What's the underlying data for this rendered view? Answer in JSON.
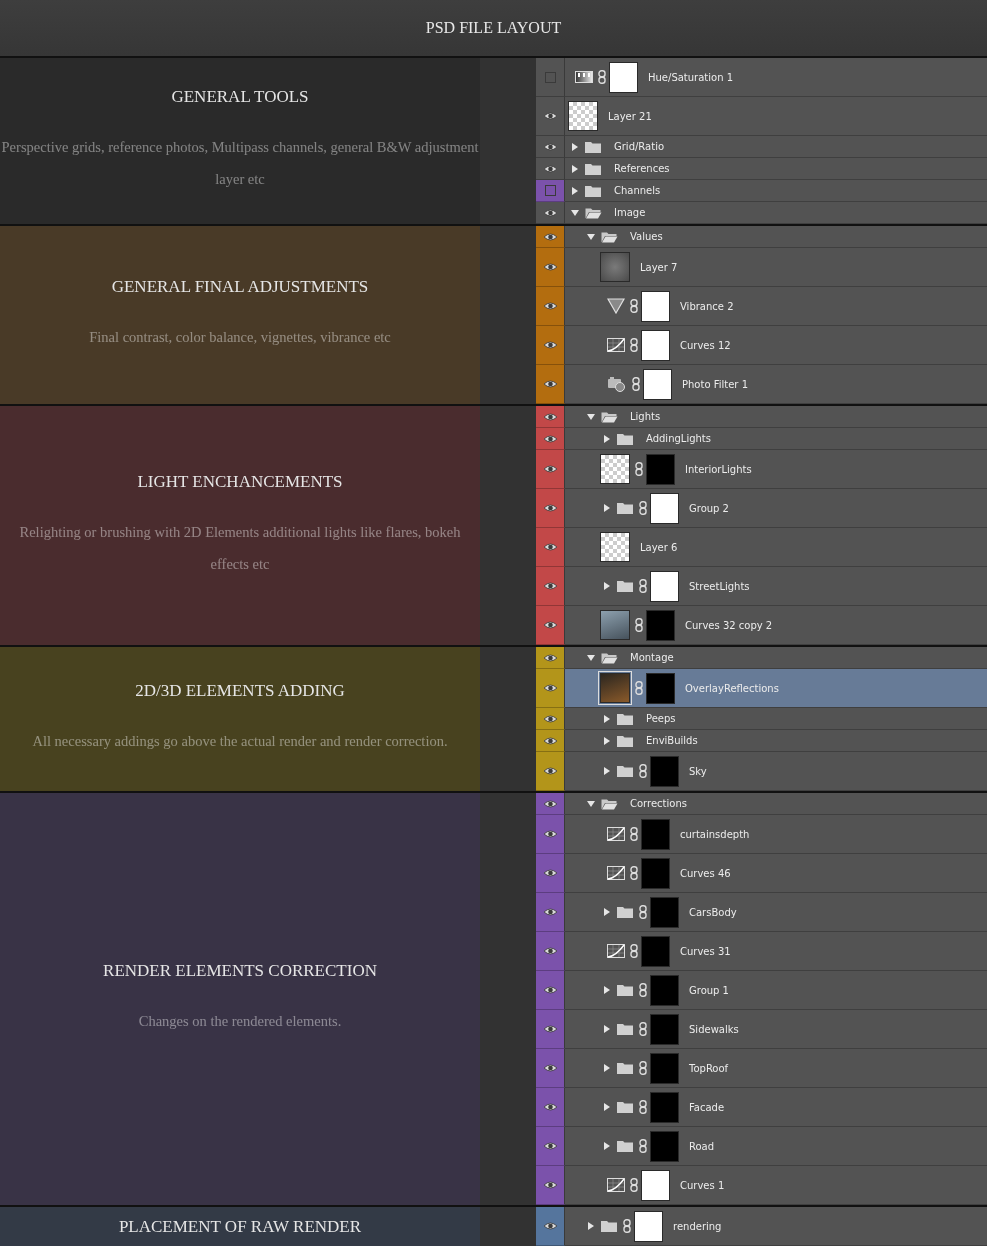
{
  "header": {
    "title": "PSD FILE LAYOUT"
  },
  "sections": [
    {
      "title": "GENERAL TOOLS",
      "description": "Perspective grids, reference photos, Multipass channels, general B&W adjustment layer etc",
      "color": "#2a2a2a",
      "layers": [
        {
          "name": "Hue/Saturation 1",
          "kind": "huesat",
          "visible": false,
          "color": "#535353",
          "selected": false,
          "mask": true,
          "mask_dark": false
        },
        {
          "name": "Layer 21",
          "kind": "transparent",
          "visible": true,
          "color": "#535353",
          "selected": false
        },
        {
          "name": "Grid/Ratio",
          "kind": "group",
          "visible": true,
          "color": "#535353",
          "selected": false,
          "expanded": false
        },
        {
          "name": "References",
          "kind": "group",
          "visible": true,
          "color": "#535353",
          "selected": false,
          "expanded": false
        },
        {
          "name": "Channels",
          "kind": "group",
          "visible": false,
          "color": "#7b52ab",
          "selected": false,
          "expanded": false
        },
        {
          "name": "Image",
          "kind": "group",
          "visible": true,
          "color": "#535353",
          "selected": false,
          "expanded": true
        }
      ]
    },
    {
      "title": "GENERAL FINAL ADJUSTMENTS",
      "description": "Final contrast, color balance, vignettes, vibrance etc",
      "color": "#493a27",
      "layers": [
        {
          "name": "Values",
          "kind": "group",
          "visible": true,
          "color": "#b36d0f",
          "selected": false,
          "expanded": true,
          "children": [
            {
              "name": "Layer 7",
              "kind": "shade",
              "visible": true,
              "color": "#b36d0f",
              "selected": false
            },
            {
              "name": "Vibrance 2",
              "kind": "vibrance",
              "visible": true,
              "color": "#b36d0f",
              "selected": false,
              "mask": true,
              "mask_dark": false
            },
            {
              "name": "Curves 12",
              "kind": "curves",
              "visible": true,
              "color": "#b36d0f",
              "selected": false,
              "mask": true,
              "mask_dark": false
            },
            {
              "name": "Photo Filter 1",
              "kind": "photofilter",
              "visible": true,
              "color": "#b36d0f",
              "selected": false,
              "mask": true,
              "mask_dark": false
            }
          ]
        }
      ]
    },
    {
      "title": "LIGHT ENCHANCEMENTS",
      "description": "Relighting or brushing with 2D Elements additional lights like flares, bokeh effects etc",
      "color": "#4a2c2e",
      "layers": [
        {
          "name": "Lights",
          "kind": "group",
          "visible": true,
          "color": "#c24848",
          "selected": false,
          "expanded": true,
          "children": [
            {
              "name": "AddingLights",
              "kind": "group",
              "visible": true,
              "color": "#c24848",
              "selected": false,
              "expanded": false
            },
            {
              "name": "InteriorLights",
              "kind": "transparent",
              "visible": true,
              "color": "#c24848",
              "selected": false,
              "mask": true,
              "mask_dark": true
            },
            {
              "name": "Group 2",
              "kind": "group",
              "visible": true,
              "color": "#c24848",
              "selected": false,
              "expanded": false,
              "mask": true,
              "mask_dark": false
            },
            {
              "name": "Layer 6",
              "kind": "transparent",
              "visible": true,
              "color": "#c24848",
              "selected": false
            },
            {
              "name": "StreetLights",
              "kind": "group",
              "visible": true,
              "color": "#c24848",
              "selected": false,
              "expanded": false,
              "mask": true,
              "mask_dark": false
            },
            {
              "name": "Curves 32 copy 2",
              "kind": "photo",
              "visible": true,
              "color": "#c24848",
              "selected": false,
              "mask": true,
              "mask_dark": true
            }
          ]
        }
      ]
    },
    {
      "title": "2D/3D ELEMENTS ADDING",
      "description": "All necessary addings go above the actual render and render correction.",
      "color": "#48421f",
      "layers": [
        {
          "name": "Montage",
          "kind": "group",
          "visible": true,
          "color": "#b3951a",
          "selected": false,
          "expanded": true,
          "children": [
            {
              "name": "OverlayReflections",
              "kind": "photo",
              "visible": true,
              "color": "#b3951a",
              "selected": true,
              "mask": true,
              "mask_dark": true
            },
            {
              "name": "Peeps",
              "kind": "group",
              "visible": true,
              "color": "#b3951a",
              "selected": false,
              "expanded": false
            },
            {
              "name": "EnviBuilds",
              "kind": "group",
              "visible": true,
              "color": "#b3951a",
              "selected": false,
              "expanded": false
            },
            {
              "name": "Sky",
              "kind": "group",
              "visible": true,
              "color": "#b3951a",
              "selected": false,
              "expanded": false,
              "mask": true,
              "mask_dark": true
            }
          ]
        }
      ]
    },
    {
      "title": "RENDER ELEMENTS CORRECTION",
      "description": "Changes on the rendered elements.",
      "color": "#393346",
      "layers": [
        {
          "name": "Corrections",
          "kind": "group",
          "visible": true,
          "color": "#7b52ab",
          "selected": false,
          "expanded": true,
          "children": [
            {
              "name": "curtainsdepth",
              "kind": "curves",
              "visible": true,
              "color": "#7b52ab",
              "selected": false,
              "mask": true,
              "mask_dark": true
            },
            {
              "name": "Curves 46",
              "kind": "curves",
              "visible": true,
              "color": "#7b52ab",
              "selected": false,
              "mask": true,
              "mask_dark": true
            },
            {
              "name": "CarsBody",
              "kind": "group",
              "visible": true,
              "color": "#7b52ab",
              "selected": false,
              "expanded": false,
              "mask": true,
              "mask_dark": true
            },
            {
              "name": "Curves 31",
              "kind": "curves",
              "visible": true,
              "color": "#7b52ab",
              "selected": false,
              "mask": true,
              "mask_dark": true
            },
            {
              "name": "Group 1",
              "kind": "group",
              "visible": true,
              "color": "#7b52ab",
              "selected": false,
              "expanded": false,
              "mask": true,
              "mask_dark": true
            },
            {
              "name": "Sidewalks",
              "kind": "group",
              "visible": true,
              "color": "#7b52ab",
              "selected": false,
              "expanded": false,
              "mask": true,
              "mask_dark": true
            },
            {
              "name": "TopRoof",
              "kind": "group",
              "visible": true,
              "color": "#7b52ab",
              "selected": false,
              "expanded": false,
              "mask": true,
              "mask_dark": true
            },
            {
              "name": "Facade",
              "kind": "group",
              "visible": true,
              "color": "#7b52ab",
              "selected": false,
              "expanded": false,
              "mask": true,
              "mask_dark": true
            },
            {
              "name": "Road",
              "kind": "group",
              "visible": true,
              "color": "#7b52ab",
              "selected": false,
              "expanded": false,
              "mask": true,
              "mask_dark": true
            },
            {
              "name": "Curves 1",
              "kind": "curves",
              "visible": true,
              "color": "#7b52ab",
              "selected": false,
              "mask": true,
              "mask_dark": false
            }
          ]
        }
      ]
    },
    {
      "title": "PLACEMENT OF RAW RENDER",
      "color": "#333a46",
      "layers": [
        {
          "name": "rendering",
          "kind": "group",
          "visible": true,
          "color": "#55759d",
          "selected": false,
          "expanded": false,
          "mask": true,
          "mask_dark": false
        }
      ]
    }
  ]
}
